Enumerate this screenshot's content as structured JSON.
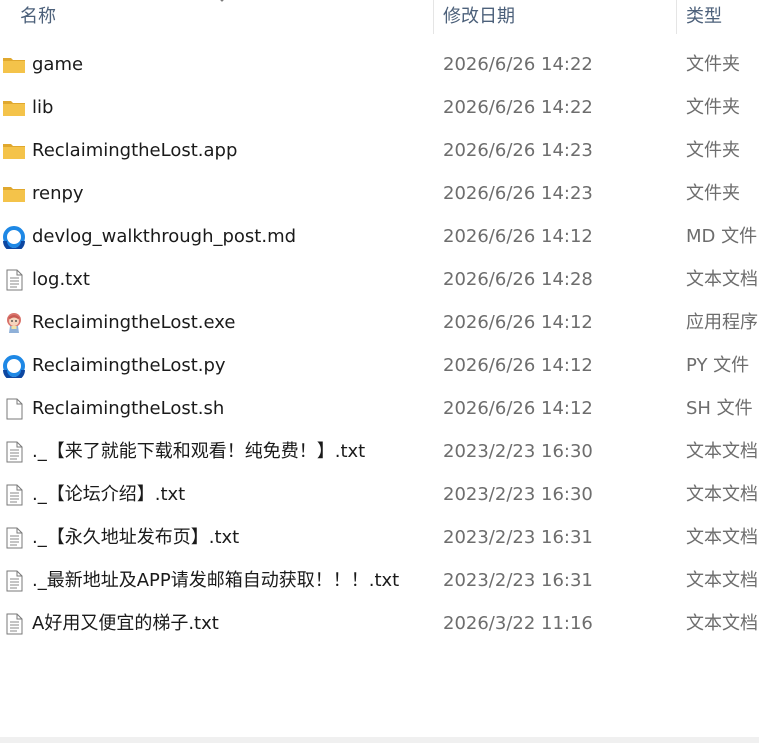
{
  "columns": {
    "name": "名称",
    "modified": "修改日期",
    "type": "类型"
  },
  "files": [
    {
      "name": "game",
      "modified": "2026/6/26 14:22",
      "type": "文件夹",
      "icon": "folder-icon"
    },
    {
      "name": "lib",
      "modified": "2026/6/26 14:22",
      "type": "文件夹",
      "icon": "folder-icon"
    },
    {
      "name": "ReclaimingtheLost.app",
      "modified": "2026/6/26 14:23",
      "type": "文件夹",
      "icon": "folder-icon"
    },
    {
      "name": "renpy",
      "modified": "2026/6/26 14:23",
      "type": "文件夹",
      "icon": "folder-icon"
    },
    {
      "name": "devlog_walkthrough_post.md",
      "modified": "2026/6/26 14:12",
      "type": "MD 文件",
      "icon": "ring-app-icon"
    },
    {
      "name": "log.txt",
      "modified": "2026/6/26 14:28",
      "type": "文本文档",
      "icon": "text-file-icon"
    },
    {
      "name": "ReclaimingtheLost.exe",
      "modified": "2026/6/26 14:12",
      "type": "应用程序",
      "icon": "game-character-icon"
    },
    {
      "name": "ReclaimingtheLost.py",
      "modified": "2026/6/26 14:12",
      "type": "PY 文件",
      "icon": "ring-app-icon"
    },
    {
      "name": "ReclaimingtheLost.sh",
      "modified": "2026/6/26 14:12",
      "type": "SH 文件",
      "icon": "blank-file-icon"
    },
    {
      "name": "._【来了就能下载和观看！纯免费！】.txt",
      "modified": "2023/2/23 16:30",
      "type": "文本文档",
      "icon": "text-file-icon"
    },
    {
      "name": "._【论坛介绍】.txt",
      "modified": "2023/2/23 16:30",
      "type": "文本文档",
      "icon": "text-file-icon"
    },
    {
      "name": "._【永久地址发布页】.txt",
      "modified": "2023/2/23 16:31",
      "type": "文本文档",
      "icon": "text-file-icon"
    },
    {
      "name": "._最新地址及APP请发邮箱自动获取！！！.txt",
      "modified": "2023/2/23 16:31",
      "type": "文本文档",
      "icon": "text-file-icon"
    },
    {
      "name": "A好用又便宜的梯子.txt",
      "modified": "2026/3/22 11:16",
      "type": "文本文档",
      "icon": "text-file-icon"
    }
  ],
  "colors": {
    "folder": "#f4c34a",
    "folder_dark": "#e0a82e",
    "ring": "#1e88e5",
    "header_text": "#4c607a",
    "name_text": "#1a1a1a",
    "meta_text": "#6d6d6d"
  }
}
